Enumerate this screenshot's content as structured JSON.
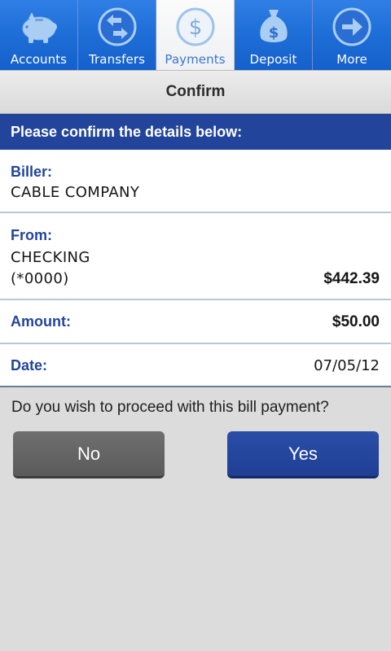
{
  "tabs": [
    {
      "label": "Accounts",
      "icon": "piggy-bank-icon",
      "active": false
    },
    {
      "label": "Transfers",
      "icon": "transfer-arrows-icon",
      "active": false
    },
    {
      "label": "Payments",
      "icon": "dollar-coin-icon",
      "active": true
    },
    {
      "label": "Deposit",
      "icon": "money-bag-icon",
      "active": false
    },
    {
      "label": "More",
      "icon": "arrow-right-circle-icon",
      "active": false
    }
  ],
  "title": "Confirm",
  "header": "Please confirm the details below:",
  "details": {
    "biller": {
      "label": "Biller:",
      "value": "CABLE COMPANY"
    },
    "from": {
      "label": "From:",
      "account": "CHECKING",
      "number": "(*0000)",
      "balance": "$442.39"
    },
    "amount": {
      "label": "Amount:",
      "value": "$50.00"
    },
    "date": {
      "label": "Date:",
      "value": "07/05/12"
    }
  },
  "question": "Do you wish to proceed with this bill payment?",
  "buttons": {
    "no": "No",
    "yes": "Yes"
  },
  "colors": {
    "tab_blue": "#1f6fd8",
    "header_navy": "#22449a",
    "label_blue": "#22449a",
    "button_no": "#616161",
    "button_yes": "#22449a"
  }
}
